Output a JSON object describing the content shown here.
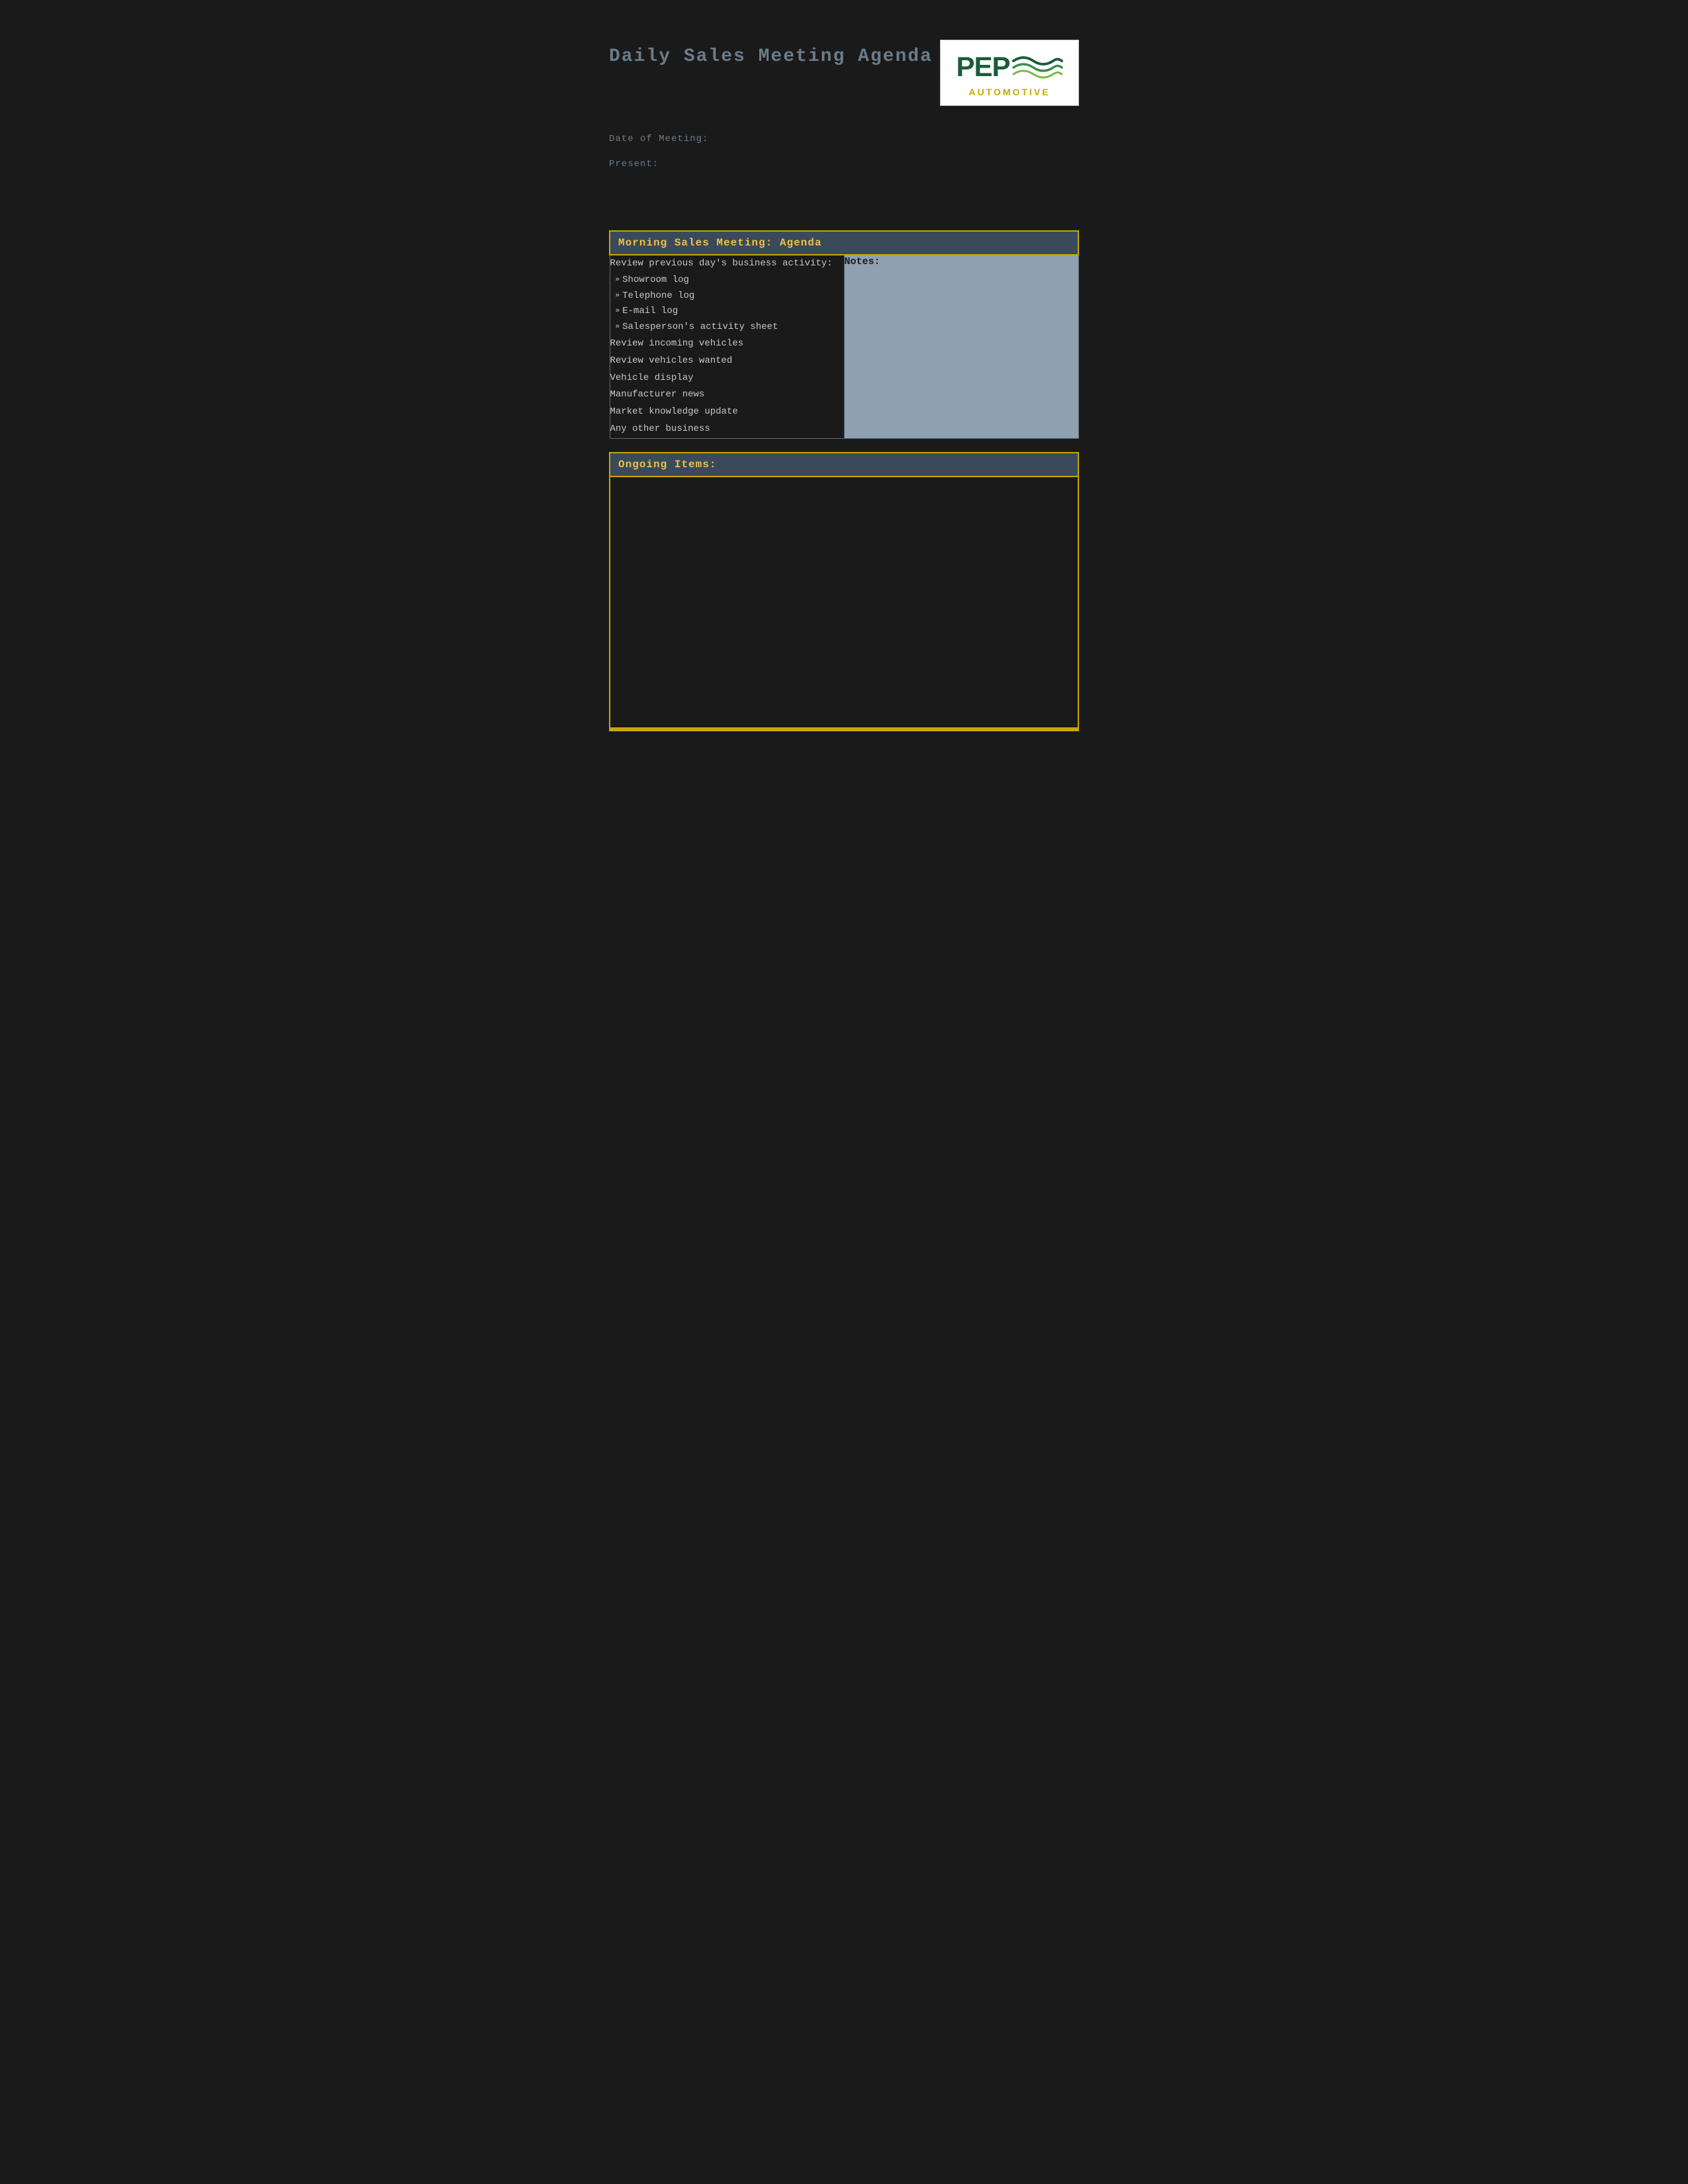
{
  "page": {
    "title": "Daily Sales Meeting Agenda",
    "logo": {
      "company": "PEP",
      "tagline": "AUTOMOTIVE"
    },
    "meta": {
      "date_label": "Date of Meeting:",
      "present_label": "Present:"
    },
    "morning_section": {
      "header": "Morning Sales Meeting: Agenda",
      "left_heading": "Review previous day's business activity:",
      "bullet_items": [
        "Showroom log",
        "Telephone log",
        "E-mail log",
        "Salesperson's activity sheet"
      ],
      "agenda_items": [
        "Review incoming vehicles",
        "Review vehicles wanted",
        "Vehicle display",
        "Manufacturer news",
        "Market knowledge update",
        "Any other business"
      ],
      "notes_label": "Notes:"
    },
    "ongoing_section": {
      "header": "Ongoing Items:"
    }
  }
}
